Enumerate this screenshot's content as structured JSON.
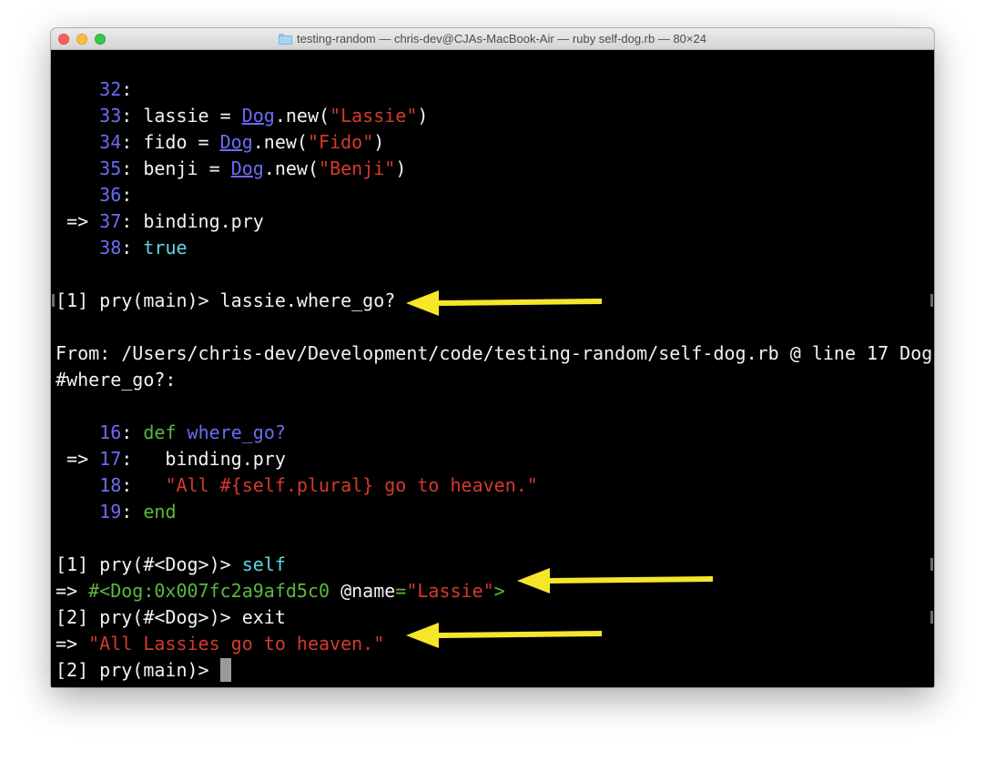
{
  "window": {
    "title": "testing-random — chris-dev@CJAs-MacBook-Air — ruby self-dog.rb — 80×24"
  },
  "terminal": {
    "l32": {
      "n": "32",
      "colon": ":"
    },
    "l33": {
      "n": "33",
      "a": ": lassie = ",
      "cls": "Dog",
      "b": ".new(",
      "s": "\"Lassie\"",
      "c": ")"
    },
    "l34": {
      "n": "34",
      "a": ": fido = ",
      "cls": "Dog",
      "b": ".new(",
      "s": "\"Fido\"",
      "c": ")"
    },
    "l35": {
      "n": "35",
      "a": ": benji = ",
      "cls": "Dog",
      "b": ".new(",
      "s": "\"Benji\"",
      "c": ")"
    },
    "l36": {
      "n": "36",
      "colon": ":"
    },
    "l37": {
      "ptr": " => ",
      "n": "37",
      "a": ": binding.pry"
    },
    "l38": {
      "n": "38",
      "colon": ": ",
      "val": "true"
    },
    "prompt1": "[1] pry(main)> lassie.where_go?",
    "from1": "From: /Users/chris-dev/Development/code/testing-random/self-dog.rb @ line 17 Dog",
    "from2": "#where_go?:",
    "l16": {
      "n": "16",
      "colon": ": ",
      "kw": "def",
      "sp": " ",
      "meth": "where_go?"
    },
    "l17": {
      "ptr": " => ",
      "n": "17",
      "a": ":   binding.pry"
    },
    "l18": {
      "n": "18",
      "a": ":   ",
      "s": "\"All #{self.plural} go to heaven.\""
    },
    "l19": {
      "n": "19",
      "colon": ": ",
      "kw": "end"
    },
    "prompt2": {
      "p": "[1] pry(#<Dog>)> ",
      "cmd": "self"
    },
    "result1": {
      "ptr": "=> ",
      "obj": "#<Dog:0x007fc2a9afd5c0",
      "ivar": " @name",
      "eq": "=",
      "s": "\"Lassie\"",
      "end": ">"
    },
    "prompt3": "[2] pry(#<Dog>)> exit",
    "result2": {
      "ptr": "=> ",
      "s": "\"All Lassies go to heaven.\""
    },
    "prompt4": "[2] pry(main)> "
  },
  "colors": {
    "line_number": "#6b6bf5",
    "string": "#d33a2c",
    "keyword": "#5ab83e",
    "constant": "#5fd7e5",
    "arrow": "#f5e629"
  }
}
